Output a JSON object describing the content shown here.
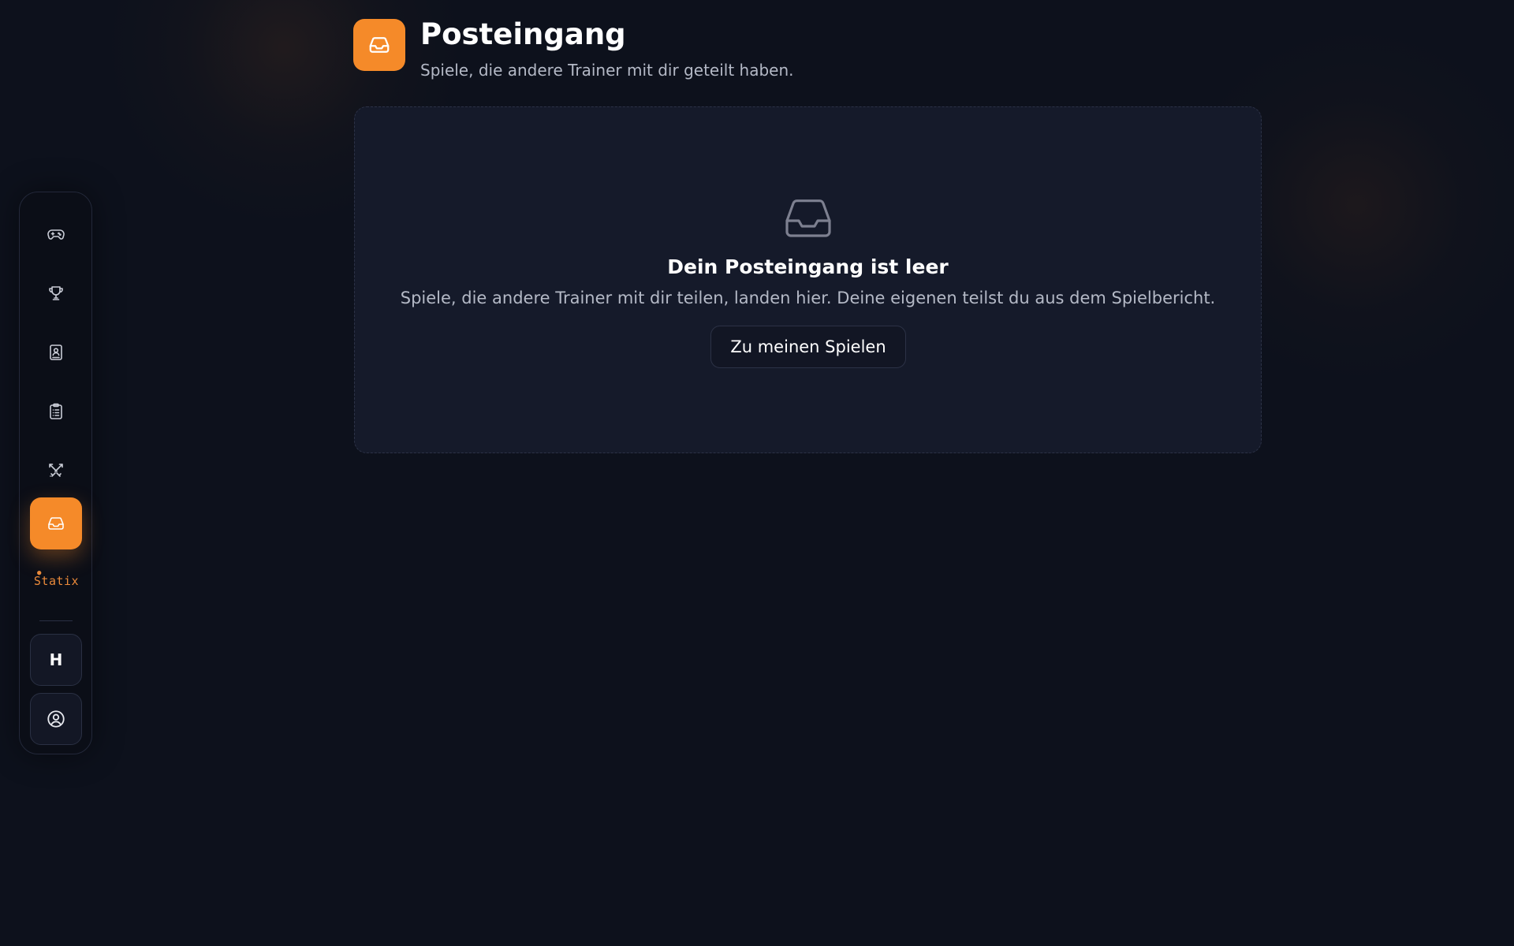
{
  "header": {
    "title": "Posteingang",
    "subtitle": "Spiele, die andere Trainer mit dir geteilt haben.",
    "icon": "inbox-icon"
  },
  "sidebar": {
    "items": [
      {
        "icon": "gamepad-icon",
        "active": false
      },
      {
        "icon": "trophy-icon",
        "active": false
      },
      {
        "icon": "contact-book-icon",
        "active": false
      },
      {
        "icon": "clipboard-list-icon",
        "active": false
      },
      {
        "icon": "crossed-swords-icon",
        "active": false
      },
      {
        "icon": "inbox-icon",
        "active": true
      }
    ],
    "brand": "Statix",
    "user_initial": "H",
    "account_icon": "user-circle-icon"
  },
  "empty_state": {
    "title": "Dein Posteingang ist leer",
    "text": "Spiele, die andere Trainer mit dir teilen, landen hier. Deine eigenen teilst du aus dem Spielbericht.",
    "button_label": "Zu meinen Spielen",
    "icon": "inbox-icon"
  },
  "colors": {
    "accent": "#f58a29",
    "background": "#0d111c",
    "card": "#151a2a"
  }
}
